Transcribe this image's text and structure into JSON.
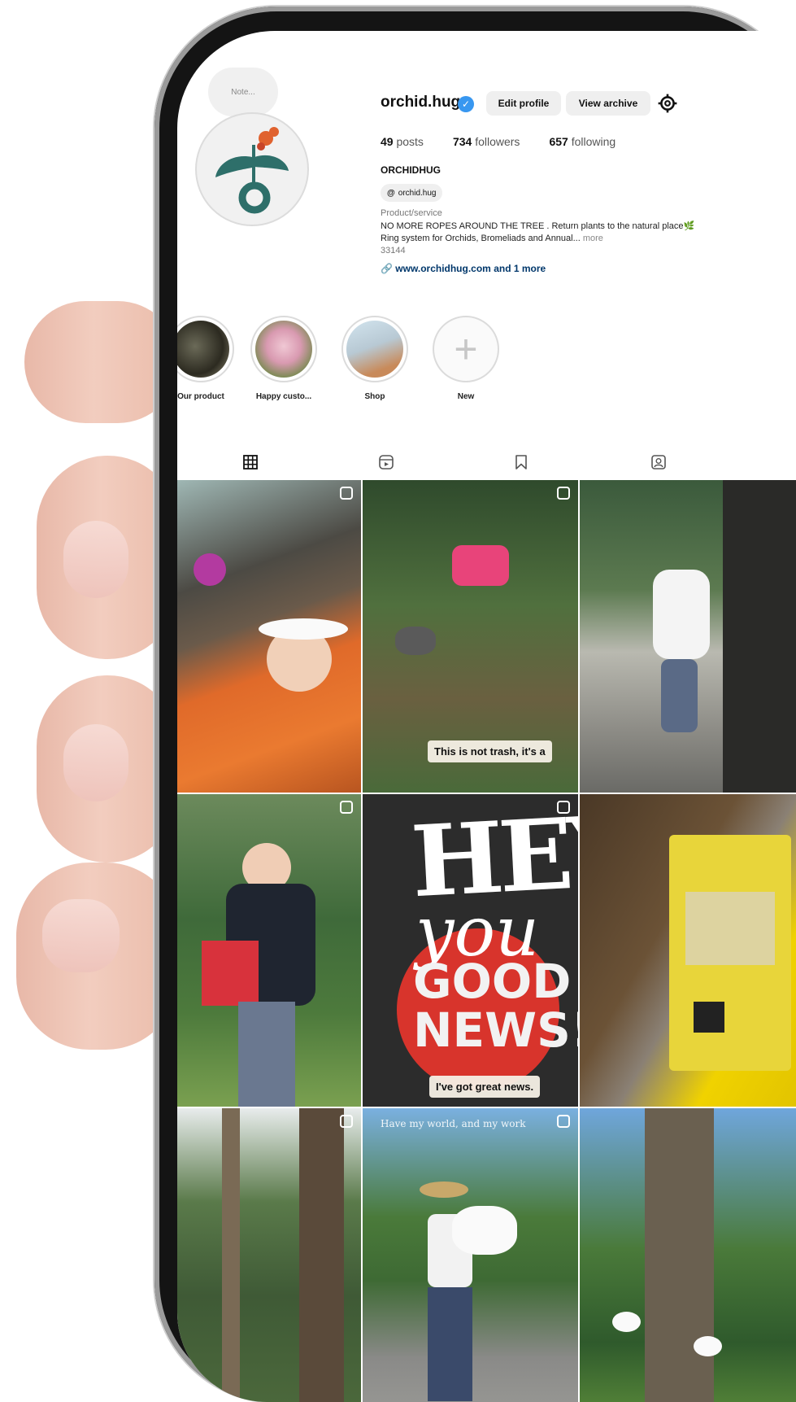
{
  "profile": {
    "note": "Note...",
    "username": "orchid.hug",
    "edit_profile": "Edit profile",
    "view_archive": "View archive",
    "posts_count": "49",
    "posts_label": "posts",
    "followers_count": "734",
    "followers_label": "followers",
    "following_count": "657",
    "following_label": "following",
    "display_name": "ORCHIDHUG",
    "threads_handle": "orchid.hug",
    "category": "Product/service",
    "bio_line1": "NO MORE ROPES AROUND THE TREE . Return plants to the natural place🌿",
    "bio_line2": "Ring system for Orchids, Bromeliads and Annual...",
    "bio_more": "more",
    "bio_number": "33144",
    "link_text": "www.orchidhug.com and 1 more"
  },
  "highlights": [
    {
      "label": "Our product"
    },
    {
      "label": "Happy custo..."
    },
    {
      "label": "Shop"
    },
    {
      "label": "New"
    }
  ],
  "tabs": [
    "posts-grid",
    "reels",
    "saved",
    "tagged"
  ],
  "posts": [
    {
      "caption": ""
    },
    {
      "caption": "This is not trash, it's a"
    },
    {
      "caption": ""
    },
    {
      "caption": ""
    },
    {
      "caption": "I've got great news.",
      "headline1": "HEY!",
      "headline2": "you",
      "headline3": "GOOD NEWS!"
    },
    {
      "caption": ""
    },
    {
      "caption": ""
    },
    {
      "caption": "Have my world, and my work"
    },
    {
      "caption": ""
    }
  ],
  "colors": {
    "verified": "#3897f0",
    "link": "#00376b",
    "logo_teal": "#2e6f6a",
    "logo_orange": "#e0622f"
  }
}
